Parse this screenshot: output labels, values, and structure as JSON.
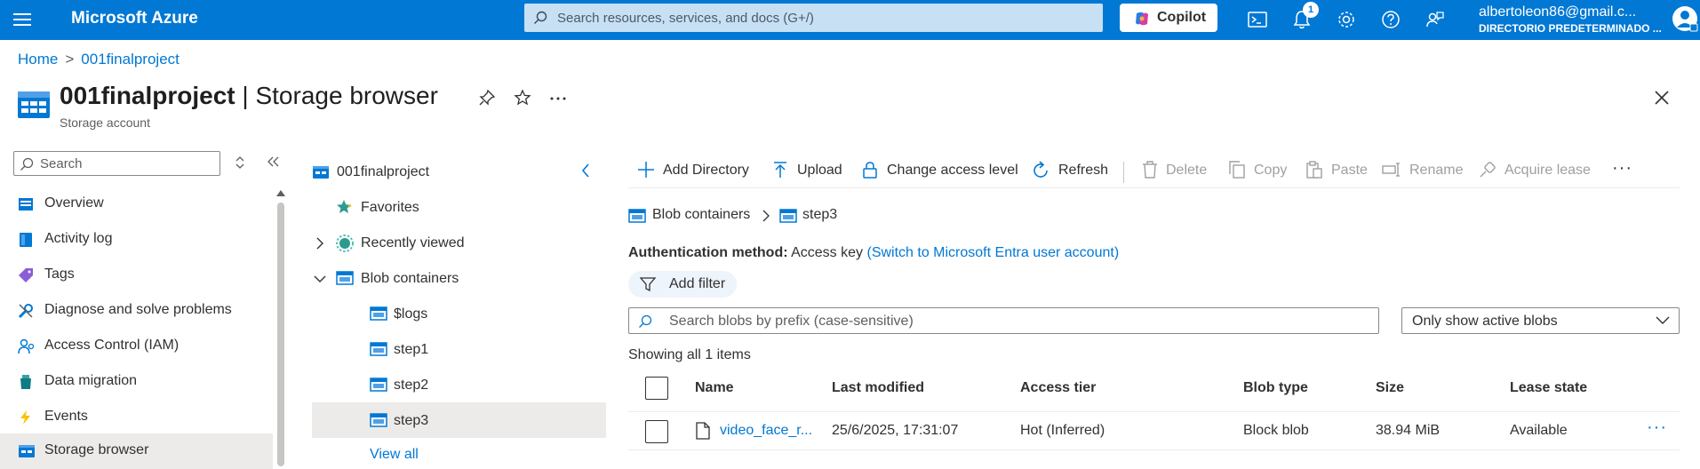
{
  "topbar": {
    "brand": "Microsoft Azure",
    "search_placeholder": "Search resources, services, and docs (G+/)",
    "copilot_label": "Copilot",
    "notification_count": "1",
    "account_name": "albertoleon86@gmail.c...",
    "account_directory": "DIRECTORIO PREDETERMINADO ..."
  },
  "breadcrumb": {
    "home": "Home",
    "resource": "001finalproject"
  },
  "header": {
    "title_bold": "001finalproject",
    "title_rest": " | Storage browser",
    "subtitle": "Storage account"
  },
  "nav": {
    "search_placeholder": "Search",
    "items": [
      {
        "label": "Overview",
        "icon": "overview-icon"
      },
      {
        "label": "Activity log",
        "icon": "activity-log-icon"
      },
      {
        "label": "Tags",
        "icon": "tag-icon"
      },
      {
        "label": "Diagnose and solve problems",
        "icon": "wrench-icon"
      },
      {
        "label": "Access Control (IAM)",
        "icon": "people-icon"
      },
      {
        "label": "Data migration",
        "icon": "data-migration-icon"
      },
      {
        "label": "Events",
        "icon": "lightning-icon"
      },
      {
        "label": "Storage browser",
        "icon": "storage-browser-icon"
      }
    ]
  },
  "tree": {
    "root": "001finalproject",
    "favorites": "Favorites",
    "recently_viewed": "Recently viewed",
    "blob_containers": "Blob containers",
    "containers": [
      "$logs",
      "step1",
      "step2",
      "step3"
    ],
    "view_all": "View all"
  },
  "toolbar": {
    "add_directory": "Add Directory",
    "upload": "Upload",
    "change_access": "Change access level",
    "refresh": "Refresh",
    "delete": "Delete",
    "copy": "Copy",
    "paste": "Paste",
    "rename": "Rename",
    "acquire_lease": "Acquire lease",
    "more": "···"
  },
  "location": {
    "parent": "Blob containers",
    "current": "step3"
  },
  "auth": {
    "label": "Authentication method:",
    "value": "Access key",
    "switch_link": "(Switch to Microsoft Entra user account)"
  },
  "filter": {
    "add_filter": "Add filter"
  },
  "blob_search": {
    "placeholder": "Search blobs by prefix (case-sensitive)"
  },
  "blob_dropdown": {
    "selected": "Only show active blobs"
  },
  "showing": "Showing all 1 items",
  "table": {
    "headers": [
      "Name",
      "Last modified",
      "Access tier",
      "Blob type",
      "Size",
      "Lease state"
    ],
    "rows": [
      {
        "name": "video_face_r...",
        "last_modified": "25/6/2025, 17:31:07",
        "access_tier": "Hot (Inferred)",
        "blob_type": "Block blob",
        "size": "38.94 MiB",
        "lease_state": "Available",
        "more": "···"
      }
    ]
  },
  "colors": {
    "azure_blue": "#0078d4",
    "selected_bg": "#edebe9"
  }
}
